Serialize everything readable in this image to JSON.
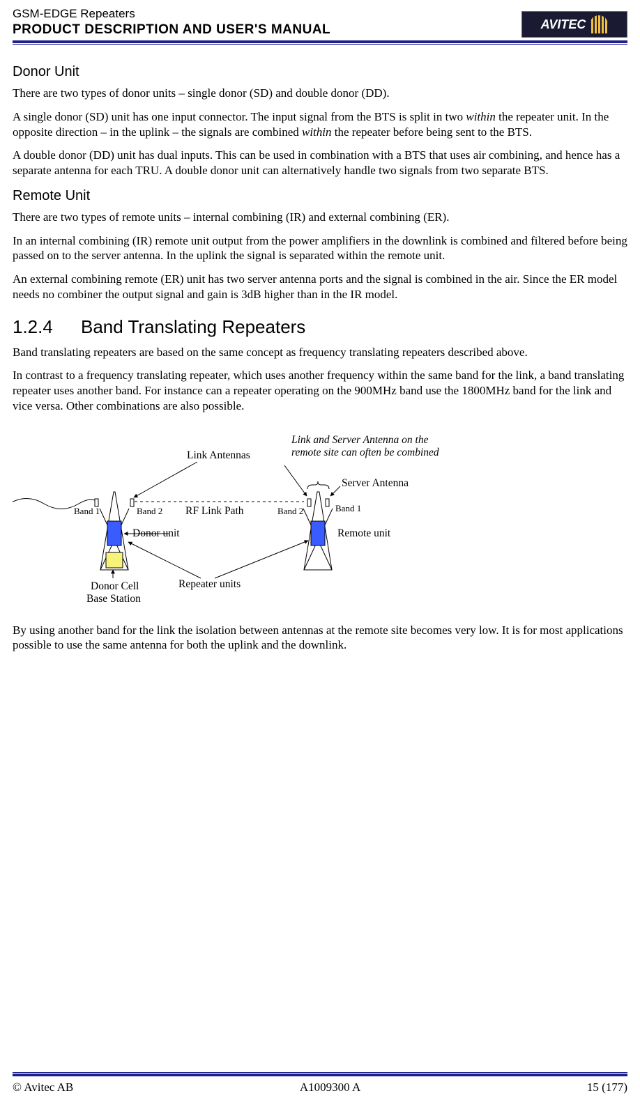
{
  "header": {
    "doc_title": "GSM-EDGE Repeaters",
    "doc_subtitle": "PRODUCT DESCRIPTION AND USER'S MANUAL",
    "logo_text": "AVITEC"
  },
  "sections": {
    "donor_unit": {
      "heading": "Donor Unit",
      "p1": "There are two types of donor units – single donor (SD) and double donor (DD).",
      "p2a": "A single donor (SD) unit has one input connector. The input signal from the BTS is split in two ",
      "p2_em1": "within",
      "p2b": " the repeater unit. In the opposite direction – in the uplink – the signals are combined ",
      "p2_em2": "within",
      "p2c": " the repeater before being sent to the BTS.",
      "p3": "A double donor (DD) unit has dual inputs. This can be used in combination with a BTS that uses air combining, and hence has a separate antenna for each TRU. A double donor unit can alternatively handle two signals from two separate BTS."
    },
    "remote_unit": {
      "heading": "Remote Unit",
      "p1": "There are two types of remote units – internal combining (IR) and external combining (ER).",
      "p2": "In an internal combining (IR) remote unit output from the power amplifiers in the downlink is combined and filtered before being passed on to the server antenna. In the uplink the signal is separated within the remote unit.",
      "p3": "An external combining remote (ER) unit has two server antenna ports and the signal is combined in the air. Since the ER model needs no combiner the output signal and gain is 3dB higher than in the IR model."
    },
    "band_translating": {
      "num": "1.2.4",
      "heading": "Band Translating Repeaters",
      "p1": "Band translating repeaters are based on the same concept as frequency translating repeaters described above.",
      "p2": "In contrast to a frequency translating repeater, which uses another frequency within the same band for the link, a band translating repeater uses another band. For instance can a repeater operating on the 900MHz band use the 1800MHz band for the link and vice versa. Other combinations are also possible.",
      "p3": "By using another band for the link the isolation between antennas at the remote site becomes very low. It is for most applications possible to use the same antenna for both the uplink and the downlink."
    }
  },
  "diagram": {
    "link_server_note_l1": "Link and Server Antenna on the",
    "link_server_note_l2": "remote site can often be combined",
    "link_antennas": "Link Antennas",
    "server_antenna": "Server Antenna",
    "rf_link_path": "RF Link Path",
    "band1": "Band 1",
    "band2": "Band 2",
    "donor_unit": "Donor unit",
    "remote_unit": "Remote unit",
    "repeater_units": "Repeater units",
    "donor_cell_l1": "Donor Cell",
    "donor_cell_l2": "Base Station"
  },
  "footer": {
    "left": "© Avitec AB",
    "center": "A1009300 A",
    "right": "15 (177)"
  }
}
